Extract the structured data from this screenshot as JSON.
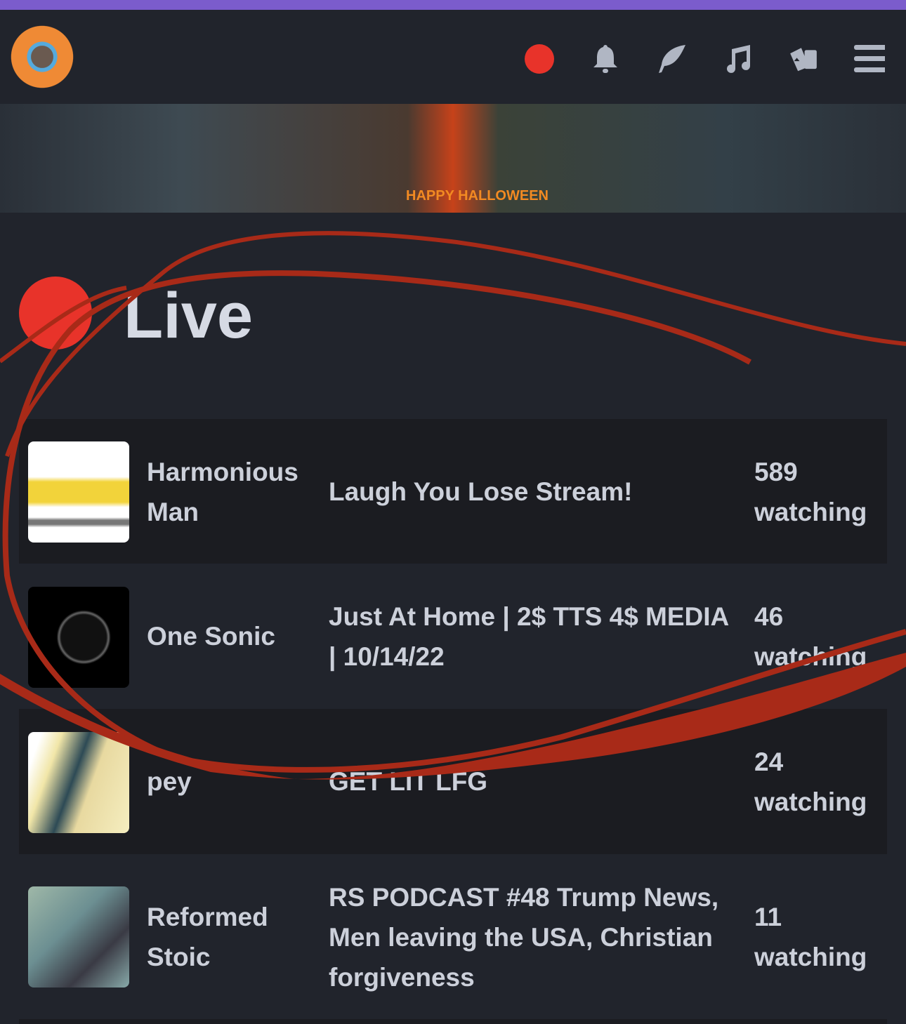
{
  "header": {
    "icons": [
      "live-dot-icon",
      "bell-icon",
      "feather-icon",
      "music-icon",
      "cards-icon",
      "menu-icon"
    ],
    "accent": "#7b5ccc",
    "live_color": "#e8332a"
  },
  "banner": {
    "text": "HAPPY HALLOWEEN"
  },
  "live": {
    "heading": "Live"
  },
  "streams": [
    {
      "user": "Harmonious Man",
      "title": "Laugh You Lose Stream!",
      "viewers": "589",
      "watching": "watching"
    },
    {
      "user": "One Sonic",
      "title": "Just At Home | 2$ TTS 4$ MEDIA | 10/14/22",
      "viewers": "46",
      "watching": "watching"
    },
    {
      "user": "pey",
      "title": "GET LIT LFG",
      "viewers": "24",
      "watching": "watching"
    },
    {
      "user": "Reformed Stoic",
      "title": "RS PODCAST #48 Trump News, Men leaving the USA, Christian forgiveness",
      "viewers": "11",
      "watching": "watching"
    }
  ]
}
